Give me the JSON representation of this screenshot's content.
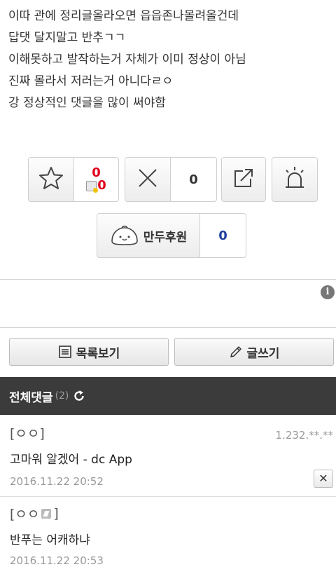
{
  "post": {
    "lines": [
      "이따 관에 정리글올라오면 읍읍존나몰려올건데",
      "답댓 달지말고 반추ㄱㄱ",
      "이해못하고 발작하는거 자체가 이미 정상이 아님",
      "진짜 몰라서 저러는거 아니다ㄹㅇ",
      "강 정상적인 댓글을 많이 써야함"
    ]
  },
  "votes": {
    "recommend_count": "0",
    "recommend_fixed_count": "0",
    "downvote_count": "0"
  },
  "donation": {
    "label": "만두후원",
    "count": "0"
  },
  "buttons": {
    "list_label": "목록보기",
    "write_label": "글쓰기"
  },
  "comments_header": {
    "title": "전체댓글",
    "count": "(2)"
  },
  "comments": [
    {
      "author": "[ㅇㅇ]",
      "ip": "1.232.**.**",
      "text": "고마워 알겠어 - dc App",
      "date": "2016.11.22 20:52"
    },
    {
      "author": "[ㅇㅇ",
      "author_suffix": "]",
      "ip": "",
      "text": "반푸는 어캐하냐",
      "date": "2016.11.22 20:53"
    }
  ],
  "colors": {
    "recommend_red": "#e0001b",
    "donation_blue": "#1f3fa0",
    "header_bg": "#3b3b3b"
  }
}
